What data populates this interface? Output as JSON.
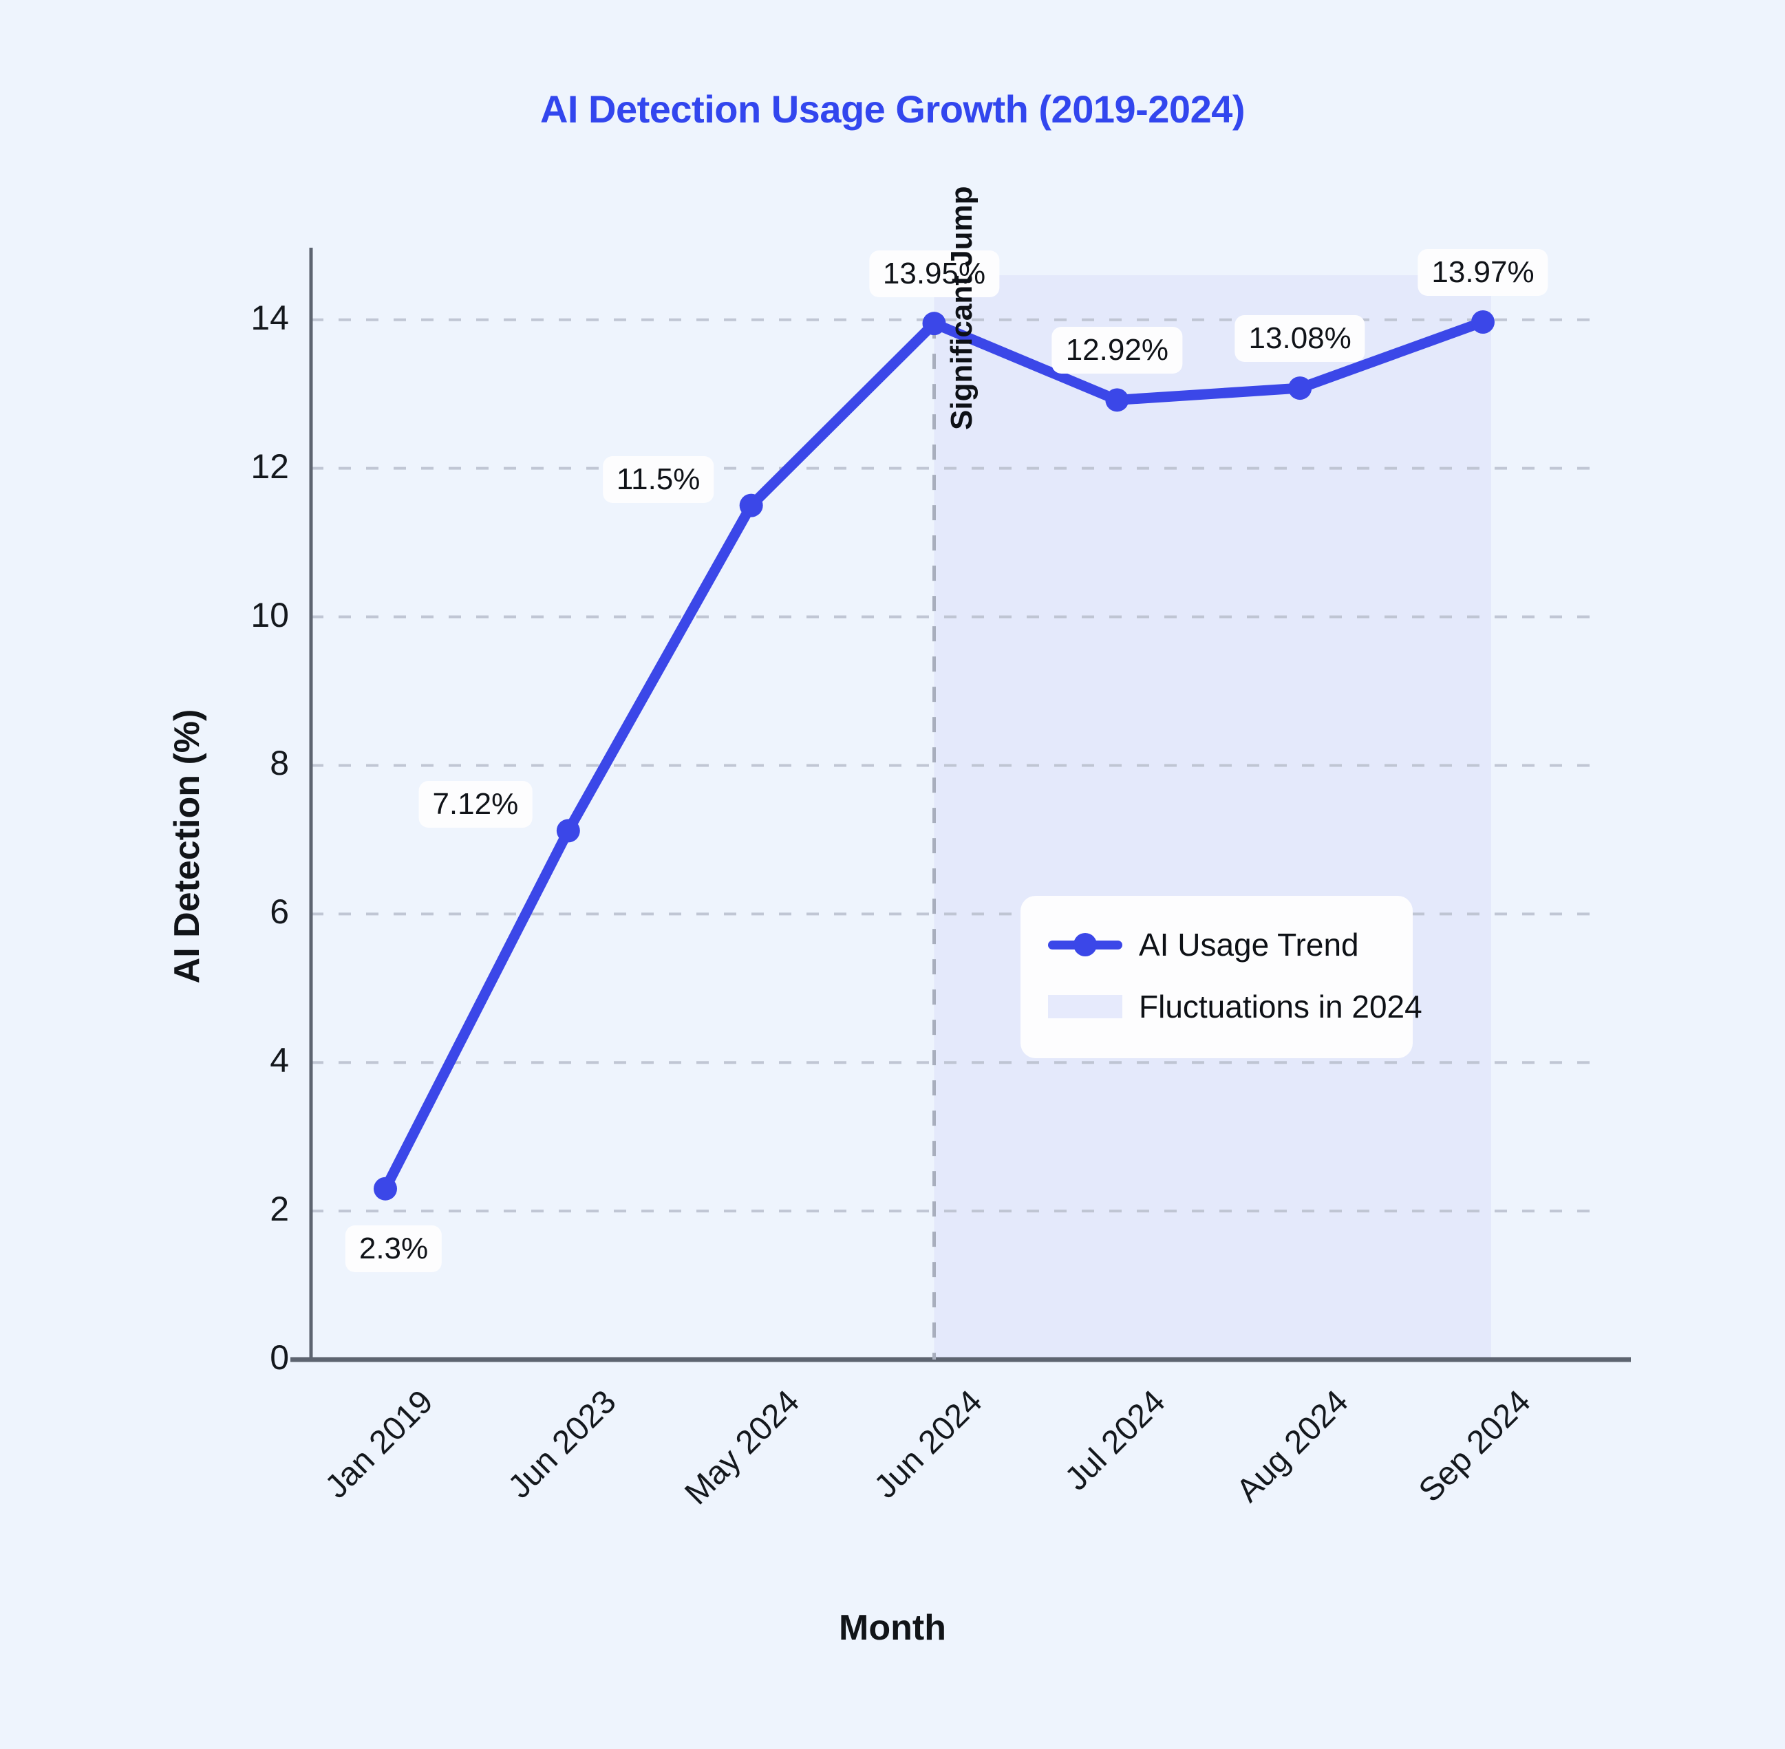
{
  "chart_data": {
    "type": "line",
    "title": "AI Detection Usage Growth (2019-2024)",
    "xlabel": "Month",
    "ylabel": "AI Detection (%)",
    "categories": [
      "Jan 2019",
      "Jun 2023",
      "May 2024",
      "Jun 2024",
      "Jul 2024",
      "Aug 2024",
      "Sep 2024"
    ],
    "series": [
      {
        "name": "AI Usage Trend",
        "color": "#3b47e8",
        "values": [
          2.3,
          7.12,
          11.5,
          13.95,
          12.92,
          13.08,
          13.97
        ],
        "point_labels": [
          "2.3%",
          "7.12%",
          "11.5%",
          "13.95%",
          "12.92%",
          "13.08%",
          "13.97%"
        ]
      }
    ],
    "ylim": [
      0,
      14.6
    ],
    "yticks": [
      0,
      2,
      4,
      6,
      8,
      10,
      12,
      14
    ],
    "ytick_labels": [
      "0",
      "2",
      "4",
      "6",
      "8",
      "10",
      "12",
      "14"
    ],
    "grid": true,
    "grid_style": "dashed-horizontal",
    "legend": {
      "position": "center-right",
      "entries": [
        {
          "label": "AI Usage Trend",
          "key": "line-marker",
          "color": "#3b47e8"
        },
        {
          "label": "Fluctuations in 2024",
          "key": "area-patch",
          "color": "#e6eafc"
        }
      ]
    },
    "shaded_region": {
      "label": "Fluctuations in 2024",
      "from_category": "Jun 2024",
      "to_category": "Sep 2024",
      "color": "#e4e9fb"
    },
    "annotations": [
      {
        "text": "Significant Jump",
        "at_category": "Jun 2024",
        "orientation": "vertical",
        "marker": "dashed-vline"
      }
    ],
    "colors": {
      "background": "#eef4fd",
      "title": "#3246ee",
      "line": "#3b47e8",
      "grid": "#b9bfcd",
      "axis": "#5d6470",
      "label_pill_bg": "#fdfdfe",
      "text": "#101318"
    }
  }
}
